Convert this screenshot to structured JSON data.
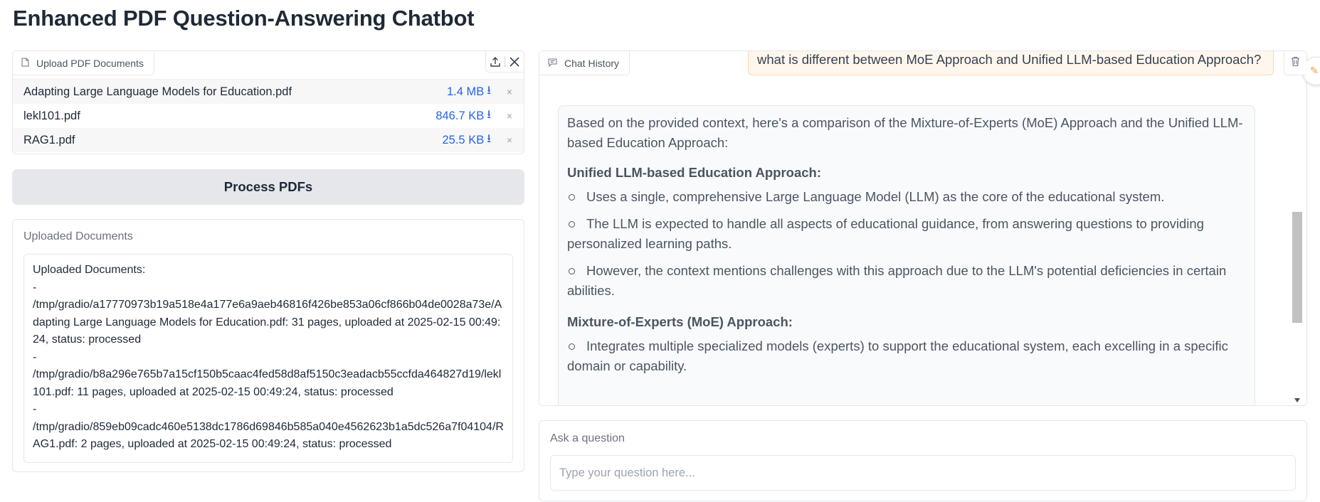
{
  "page": {
    "title": "Enhanced PDF Question-Answering Chatbot"
  },
  "upload": {
    "label": "Upload PDF Documents",
    "files": [
      {
        "name": "Adapting Large Language Models for Education.pdf",
        "size": "1.4 MB",
        "remove": "×"
      },
      {
        "name": "lekl101.pdf",
        "size": "846.7 KB",
        "remove": "×"
      },
      {
        "name": "RAG1.pdf",
        "size": "25.5 KB",
        "remove": "×"
      }
    ]
  },
  "process_button": {
    "label": "Process PDFs"
  },
  "uploaded_docs": {
    "label": "Uploaded Documents",
    "lines": [
      "Uploaded Documents:",
      "-",
      "/tmp/gradio/a17770973b19a518e4a177e6a9aeb46816f426be853a06cf866b04de0028a73e/Adapting Large Language Models for Education.pdf: 31 pages, uploaded at 2025-02-15 00:49:24, status: processed",
      "-",
      "/tmp/gradio/b8a296e765b7a15cf150b5caac4fed58d8af5150c3eadacb55ccfda464827d19/lekl101.pdf: 11 pages, uploaded at 2025-02-15 00:49:24, status: processed",
      "-",
      "/tmp/gradio/859eb09cadc460e5138dc1786d69846b585a040e4562623b1a5dc526a7f04104/RAG1.pdf: 2 pages, uploaded at 2025-02-15 00:49:24, status: processed"
    ]
  },
  "chat": {
    "label": "Chat History",
    "user_message": "what is different between MoE Approach and Unified LLM-based Education Approach?",
    "bot_intro": "Based on the provided context, here's a comparison of the Mixture-of-Experts (MoE) Approach and the Unified LLM-based Education Approach:",
    "section1_heading": "Unified LLM-based Education Approach:",
    "section1_items": [
      "Uses a single, comprehensive Large Language Model (LLM) as the core of the educational system.",
      "The LLM is expected to handle all aspects of educational guidance, from answering questions to providing personalized learning paths.",
      "However, the context mentions challenges with this approach due to the LLM's potential deficiencies in certain abilities."
    ],
    "section2_heading": "Mixture-of-Experts (MoE) Approach:",
    "section2_items": [
      "Integrates multiple specialized models (experts) to support the educational system, each excelling in a specific domain or capability."
    ]
  },
  "ask": {
    "label": "Ask a question",
    "placeholder": "Type your question here..."
  },
  "colors": {
    "accent_blue": "#2563eb",
    "user_bubble_bg": "#fff7ed",
    "user_bubble_border": "#fcd9a8",
    "button_bg": "#e5e7eb"
  }
}
